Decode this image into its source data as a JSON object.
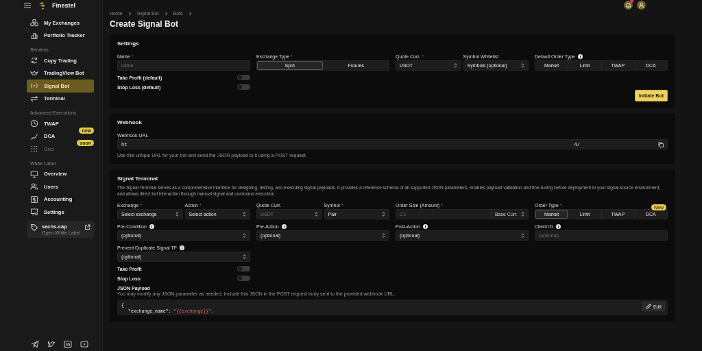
{
  "app": {
    "name": "Finestel",
    "notification_badge": true
  },
  "sidebar": {
    "sections": [
      {
        "items": [
          {
            "label": "My Exchanges",
            "selected": false,
            "disabled": false
          },
          {
            "label": "Portfolio Tracker",
            "selected": false,
            "disabled": false
          }
        ]
      },
      {
        "title": "Services",
        "items": [
          {
            "label": "Copy Trading",
            "selected": false,
            "disabled": false
          },
          {
            "label": "TradingView Bot",
            "selected": false,
            "disabled": false
          },
          {
            "label": "Signal Bot",
            "selected": true,
            "disabled": false
          },
          {
            "label": "Terminal",
            "selected": false,
            "disabled": false
          }
        ]
      },
      {
        "title": "Advanced Executions",
        "items": [
          {
            "label": "TWAP",
            "selected": false,
            "disabled": false
          },
          {
            "label": "DCA",
            "selected": false,
            "disabled": false,
            "badge": "new"
          },
          {
            "label": "Grid",
            "selected": false,
            "disabled": true,
            "badge": "soon"
          }
        ]
      },
      {
        "title": "White Label",
        "items": [
          {
            "label": "Overview",
            "selected": false,
            "disabled": false
          },
          {
            "label": "Users",
            "selected": false,
            "disabled": false
          },
          {
            "label": "Accounting",
            "selected": false,
            "disabled": false
          },
          {
            "label": "Settings",
            "selected": false,
            "disabled": false
          }
        ]
      }
    ],
    "workspace": {
      "title": "sachs-cap",
      "subtitle": "Open White Label"
    }
  },
  "breadcrumb": [
    "Home",
    "Signal Bot",
    "Bots"
  ],
  "page_title": "Create Signal Bot",
  "settings": {
    "title": "Settings",
    "mark": "*",
    "fields": [
      {
        "kind": "input",
        "label": "Name",
        "required": true,
        "placeholder": "name"
      },
      {
        "kind": "segmented",
        "label": "Exchange Type",
        "required": true,
        "options": [
          {
            "label": "Spot",
            "selected": true
          },
          {
            "label": "Futures",
            "selected": false
          }
        ]
      },
      {
        "kind": "pair",
        "parts": [
          {
            "kind": "select",
            "label": "Quote Curr.",
            "required": true,
            "value": "USDT",
            "disabled": false
          },
          {
            "kind": "select",
            "label": "Symbol Whitelist",
            "required": false,
            "value": "Symbols (optional)",
            "disabled": false
          }
        ]
      },
      {
        "kind": "segmented",
        "label": "Default Order Type",
        "info": true,
        "options": [
          {
            "label": "Market",
            "selected": false
          },
          {
            "label": "Limit",
            "selected": false
          },
          {
            "label": "TWAP",
            "selected": false
          },
          {
            "label": "DCA",
            "selected": false
          }
        ]
      }
    ],
    "toggles": [
      {
        "label": "Take Profit (default)",
        "on": false
      },
      {
        "label": "Stop Loss (default)",
        "on": false
      }
    ],
    "button": "Initiate Bot"
  },
  "webhook": {
    "title": "Webhook",
    "label": "Webhook URL",
    "value_start": "ht",
    "value_end": "4/",
    "help": "Use this unique URL for your bot and send the JSON payload to it using a POST request."
  },
  "terminal": {
    "title": "Signal Terminal",
    "mark": "*",
    "description": "The Signal Terminal serves as a comprehensive interface for designing, testing, and executing signal payloads. It provides a reference schema of all supported JSON parameters, enables payload validation and fine-tuning before deployment to your signal source environment, and allows direct bot interaction through manual signal and command execution.",
    "fields": [
      {
        "kind": "pair",
        "parts": [
          {
            "kind": "select",
            "label": "Exchange",
            "required": true,
            "value": "Select exchange",
            "disabled": false
          },
          {
            "kind": "select",
            "label": "Action",
            "required": true,
            "value": "Select action",
            "disabled": false
          }
        ]
      },
      {
        "kind": "pair",
        "parts": [
          {
            "kind": "select",
            "label": "Quote Curr.",
            "required": false,
            "value": "USDT",
            "disabled": true
          },
          {
            "kind": "select",
            "label": "Symbol",
            "required": true,
            "value": "Pair",
            "disabled": false
          }
        ]
      },
      {
        "kind": "amount",
        "label": "Order Size (Amount)",
        "required": true,
        "placeholder": "0.1",
        "unit": "Base Curr."
      },
      {
        "kind": "segmented",
        "label": "Order Type",
        "required": true,
        "options": [
          {
            "label": "Market",
            "selected": true
          },
          {
            "label": "Limit",
            "selected": false
          },
          {
            "label": "TWAP",
            "selected": false
          },
          {
            "label": "DCA",
            "selected": false,
            "badge": "New"
          }
        ]
      },
      {
        "kind": "select",
        "label": "Pre-Condition",
        "info": true,
        "value": "(optional)",
        "disabled": false
      },
      {
        "kind": "select",
        "label": "Pre-Action",
        "info": true,
        "value": "(optional)",
        "disabled": false
      },
      {
        "kind": "select",
        "label": "Post-Action",
        "info": true,
        "value": "(optional)",
        "disabled": false
      },
      {
        "kind": "input",
        "label": "Client ID",
        "info": true,
        "placeholder": "(optional)"
      },
      {
        "kind": "select",
        "label": "Prevent Duplicate Signal TF",
        "info": true,
        "value": "(optional)",
        "disabled": false
      }
    ],
    "toggles": [
      {
        "label": "Take Profit",
        "on": false
      },
      {
        "label": "Stop Loss",
        "on": false
      }
    ],
    "payload": {
      "title": "JSON Payload",
      "help": "You may modify any JSON parameter as needed. Include this JSON in the POST request body sent to the provided webhook URL.",
      "edit": "Edit",
      "lines": [
        [
          {
            "kind": "punct",
            "text": "{"
          }
        ],
        [
          {
            "kind": "key",
            "text": "\"exchange_name\": "
          },
          {
            "kind": "string",
            "text": "\"{{exchange}}\","
          }
        ]
      ]
    }
  }
}
